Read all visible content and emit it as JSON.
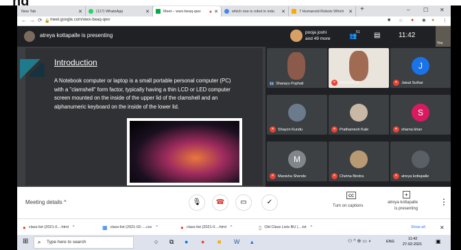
{
  "browser": {
    "tabs": [
      {
        "label": "New Tab"
      },
      {
        "label": "(117) WhatsApp"
      },
      {
        "label": "Meet – wwx-beaq-qwv"
      },
      {
        "label": "which one is robot in indu"
      },
      {
        "label": "7 Humanoid Robots Which"
      }
    ],
    "new_tab": "+",
    "url": "meet.google.com/wwx-beaq-qwv",
    "win_min": "–",
    "win_max": "☐",
    "win_close": "✕"
  },
  "meet": {
    "presenter_text": "atreya kottapalle is presenting",
    "participants_name": "pooja joshi",
    "participants_more": "and 49 more",
    "people_count": "51",
    "time": "11:42",
    "you_label": "You"
  },
  "slide": {
    "title": "Introduction",
    "body": "A Notebook computer or laptop is a small portable personal computer (PC) with a \"clamshell\" form factor, typically having a thin LCD or LED computer screen mounted on the inside of the upper lid of the clamshell and an alphanumeric keyboard on the inside of the lower lid."
  },
  "participants": [
    {
      "name": "Sharayu Pophali",
      "initial": ""
    },
    {
      "name": "DCA DACN",
      "initial": ""
    },
    {
      "name": "Jaisal Suthar",
      "initial": "J",
      "color": "#1a73e8"
    },
    {
      "name": "Shayon Kundu",
      "initial": ""
    },
    {
      "name": "Prathamesh Kale",
      "initial": ""
    },
    {
      "name": "sharna khan",
      "initial": "S",
      "color": "#d81b60"
    },
    {
      "name": "Manisha Shende",
      "initial": "M",
      "color": "#80868b"
    },
    {
      "name": "Chetna Bindra",
      "initial": ""
    },
    {
      "name": "atreya kottapalle",
      "initial": ""
    }
  ],
  "controls": {
    "meeting_details": "Meeting details",
    "captions": "Turn on captions",
    "presenting_name": "atreya kottapalle",
    "presenting_label": "is presenting"
  },
  "downloads": [
    {
      "name": "class-list (2021-0....html"
    },
    {
      "name": "class-list (2021-02-....csv"
    },
    {
      "name": "class-list (2021-0....html"
    },
    {
      "name": "Old Class Lists BU (....txt"
    }
  ],
  "downloads_show_all": "Show all",
  "taskbar": {
    "search_placeholder": "Type here to search",
    "lang": "ENG",
    "time": "11:42",
    "date": "27-02-2021"
  },
  "crop_fragment": "ng"
}
